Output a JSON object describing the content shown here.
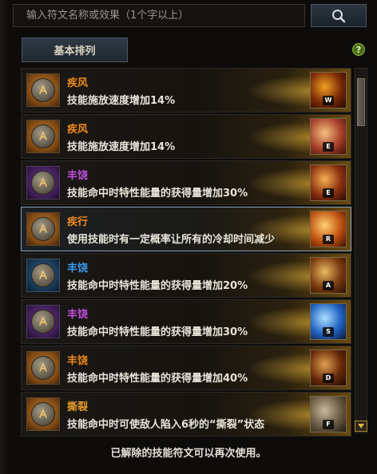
{
  "search": {
    "placeholder": "输入符文名称或效果（1个字以上）"
  },
  "sort": {
    "label": "基本排列"
  },
  "help": {
    "label": "?"
  },
  "runes": [
    {
      "name": "疾风",
      "effect": "技能施放速度增加14%",
      "name_color": "orange",
      "rune_bg": "gold",
      "skill_key": "W",
      "skill_colors": [
        "#f0a020",
        "#7a2a08",
        "#200802"
      ]
    },
    {
      "name": "疾风",
      "effect": "技能施放速度增加14%",
      "name_color": "orange",
      "rune_bg": "gold",
      "skill_key": "E",
      "skill_colors": [
        "#f4c080",
        "#a8402a",
        "#3a0c08"
      ]
    },
    {
      "name": "丰饶",
      "effect": "技能命中时特性能量的获得量增加30%",
      "name_color": "purple",
      "rune_bg": "purple",
      "skill_key": "E",
      "skill_colors": [
        "#f6b050",
        "#8a3010",
        "#2a0a02"
      ]
    },
    {
      "name": "疾行",
      "effect": "使用技能时有一定概率让所有的冷却时间减少",
      "name_color": "orange",
      "rune_bg": "gold",
      "skill_key": "R",
      "skill_colors": [
        "#ffd070",
        "#c05010",
        "#3a1002"
      ]
    },
    {
      "name": "丰饶",
      "effect": "技能命中时特性能量的获得量增加20%",
      "name_color": "blue",
      "rune_bg": "blue",
      "skill_key": "A",
      "skill_colors": [
        "#e8b860",
        "#7a3a10",
        "#2a1004"
      ]
    },
    {
      "name": "丰饶",
      "effect": "技能命中时特性能量的获得量增加30%",
      "name_color": "purple",
      "rune_bg": "purple",
      "skill_key": "S",
      "skill_colors": [
        "#a8e0ff",
        "#2060c0",
        "#081838"
      ]
    },
    {
      "name": "丰饶",
      "effect": "技能命中时特性能量的获得量增加40%",
      "name_color": "orange",
      "rune_bg": "gold",
      "skill_key": "D",
      "skill_colors": [
        "#e0a050",
        "#6a2a0a",
        "#1c0802"
      ]
    },
    {
      "name": "撕裂",
      "effect": "技能命中时可使敌人陷入6秒的“撕裂”状态",
      "name_color": "gold",
      "rune_bg": "gold",
      "skill_key": "F",
      "skill_colors": [
        "#c8b89a",
        "#6a5a44",
        "#201a12"
      ]
    }
  ],
  "footer": {
    "note": "已解除的技能符文可以再次使用。"
  }
}
